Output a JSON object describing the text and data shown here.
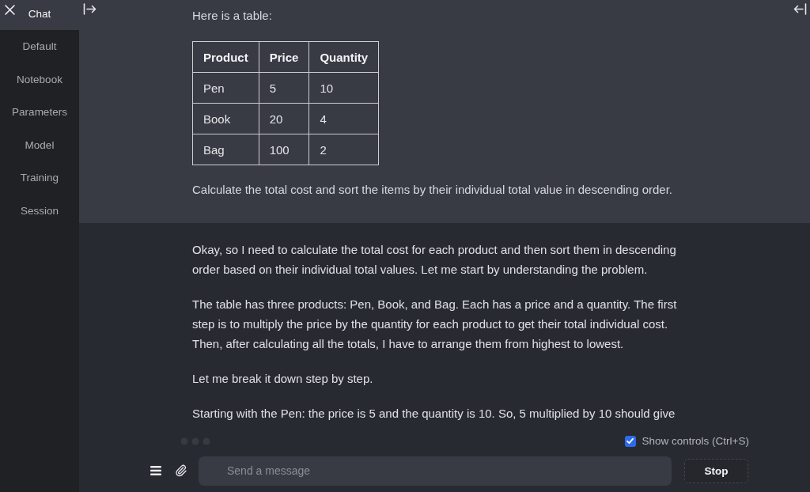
{
  "sidebar": {
    "tabs": [
      {
        "label": "Chat",
        "selected": true
      },
      {
        "label": "Default",
        "selected": false
      },
      {
        "label": "Notebook",
        "selected": false
      },
      {
        "label": "Parameters",
        "selected": false
      },
      {
        "label": "Model",
        "selected": false
      },
      {
        "label": "Training",
        "selected": false
      },
      {
        "label": "Session",
        "selected": false
      }
    ]
  },
  "chat": {
    "user_message": {
      "intro": "Here is a table:",
      "table": {
        "columns": [
          "Product",
          "Price",
          "Quantity"
        ],
        "rows": [
          [
            "Pen",
            "5",
            "10"
          ],
          [
            "Book",
            "20",
            "4"
          ],
          [
            "Bag",
            "100",
            "2"
          ]
        ]
      },
      "question": "Calculate the total cost and sort the items by their individual total value in descending order."
    },
    "assistant_message": {
      "paragraphs": [
        "Okay, so I need to calculate the total cost for each product and then sort them in descending order based on their individual total values. Let me start by understanding the problem.",
        "The table has three products: Pen, Book, and Bag. Each has a price and a quantity. The first step is to multiply the price by the quantity for each product to get their total individual cost. Then, after calculating all the totals, I have to arrange them from highest to lowest.",
        "Let me break it down step by step.",
        "Starting with the Pen: the price is 5 and the quantity is 10. So, 5 multiplied by 10 should give"
      ]
    }
  },
  "composer": {
    "show_controls": {
      "label": "Show controls (Ctrl+S)",
      "checked": true
    },
    "input": {
      "placeholder": "Send a message"
    },
    "stop_button": {
      "label": "Stop"
    }
  }
}
